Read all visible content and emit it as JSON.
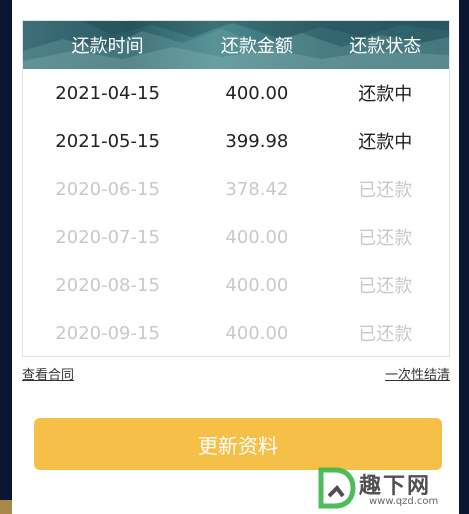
{
  "table": {
    "headers": [
      "还款时间",
      "还款金额",
      "还款状态"
    ],
    "rows": [
      {
        "date": "2021-04-15",
        "amount": "400.00",
        "status": "还款中",
        "state": "active"
      },
      {
        "date": "2021-05-15",
        "amount": "399.98",
        "status": "还款中",
        "state": "active"
      },
      {
        "date": "2020-06-15",
        "amount": "378.42",
        "status": "已还款",
        "state": "done"
      },
      {
        "date": "2020-07-15",
        "amount": "400.00",
        "status": "已还款",
        "state": "done"
      },
      {
        "date": "2020-08-15",
        "amount": "400.00",
        "status": "已还款",
        "state": "done"
      },
      {
        "date": "2020-09-15",
        "amount": "400.00",
        "status": "已还款",
        "state": "done"
      }
    ]
  },
  "links": {
    "view_contract": "查看合同",
    "one_time_settle": "一次性结清"
  },
  "cta": {
    "label": "更新资料"
  },
  "watermark": {
    "text": "趣下网",
    "url": "www.qzd.com"
  },
  "colors": {
    "header_bg": "#3c6f78",
    "cta_bg": "#f6bf47",
    "active_text": "#222222",
    "done_text": "#c9c9c9"
  }
}
